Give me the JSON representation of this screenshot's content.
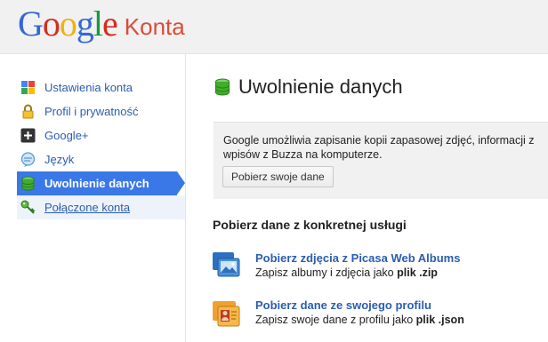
{
  "header": {
    "logo_letters": [
      "G",
      "o",
      "o",
      "g",
      "l",
      "e"
    ],
    "product": "Konta"
  },
  "sidebar": {
    "items": [
      {
        "label": "Ustawienia konta",
        "icon": "account-settings-icon"
      },
      {
        "label": "Profil i prywatność",
        "icon": "lock-icon"
      },
      {
        "label": "Google+",
        "icon": "google-plus-icon"
      },
      {
        "label": "Język",
        "icon": "language-icon"
      },
      {
        "label": "Uwolnienie danych",
        "icon": "data-liberation-icon",
        "active": true
      },
      {
        "label": "Połączone konta",
        "icon": "key-icon"
      }
    ]
  },
  "main": {
    "title": "Uwolnienie danych",
    "info_line1": "Google umożliwia zapisanie kopii zapasowej zdjęć, informacji z",
    "info_line2": "wpisów z Buzza na komputerze.",
    "download_button": "Pobierz swoje dane",
    "section_heading": "Pobierz dane z konkretnej usługi",
    "services": [
      {
        "title": "Pobierz zdjęcia z Picasa Web Albums",
        "desc_prefix": "Zapisz albumy i zdjęcia jako ",
        "desc_bold": "plik .zip",
        "icon": "picasa-photos-icon"
      },
      {
        "title": "Pobierz dane ze swojego profilu",
        "desc_prefix": "Zapisz swoje dane z profilu jako ",
        "desc_bold": "plik .json",
        "icon": "profile-icon"
      }
    ]
  },
  "colors": {
    "accent": "#3b78e7",
    "link": "#2a5db0",
    "header_bg": "#f1f1f1"
  }
}
